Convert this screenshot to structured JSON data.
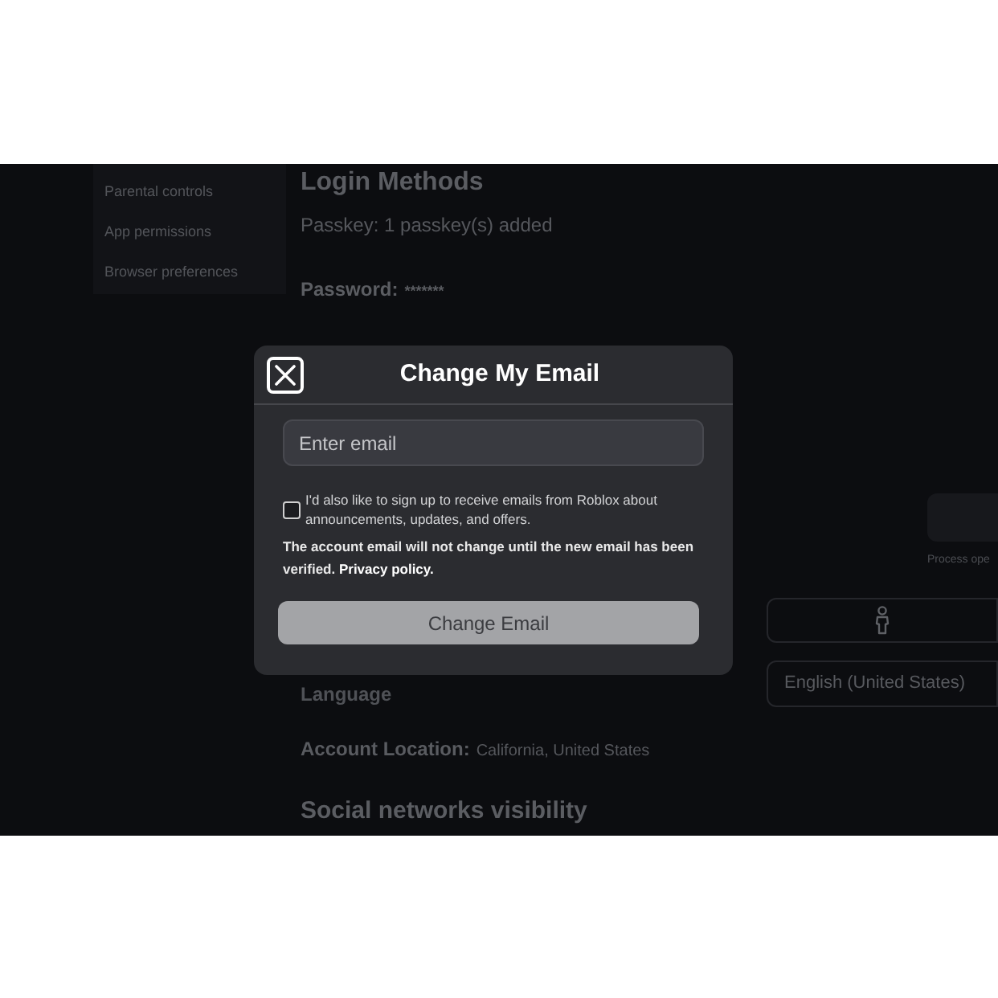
{
  "sidebar": {
    "items": [
      {
        "label": "Parental controls"
      },
      {
        "label": "App permissions"
      },
      {
        "label": "Browser preferences"
      }
    ]
  },
  "login_methods": {
    "title": "Login Methods",
    "passkey": "Passkey: 1 passkey(s) added",
    "password": {
      "label": "Password:",
      "value": "*******"
    }
  },
  "side_panel": {
    "caption": "Process ope"
  },
  "language": {
    "label": "Language",
    "value": "English (United States)"
  },
  "account_location": {
    "label": "Account Location:",
    "value": "California, United States"
  },
  "social_heading": "Social networks visibility",
  "dialog": {
    "title": "Change My Email",
    "email_field": {
      "placeholder": "Enter email"
    },
    "newsletter": {
      "label": "I'd also like to sign up to receive emails from Roblox about announcements, updates, and offers.",
      "checked": false
    },
    "notice": {
      "text": "The account email will not change until the new email has been verified.",
      "link": "Privacy policy."
    },
    "button": {
      "label": "Change Email",
      "disabled": true
    }
  }
}
